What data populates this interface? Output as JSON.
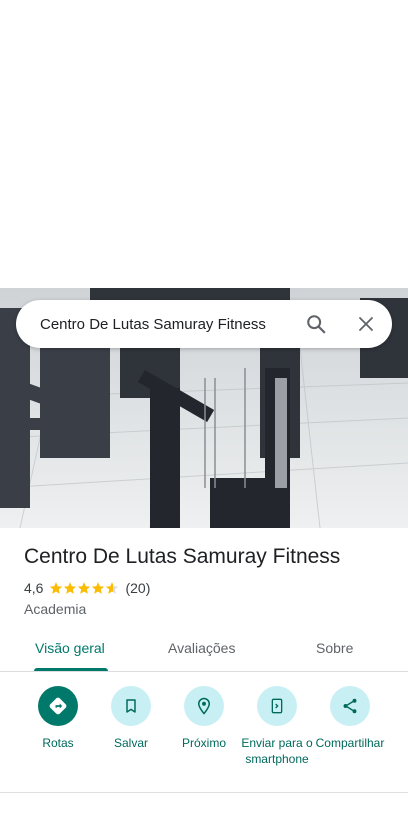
{
  "search": {
    "query": "Centro De Lutas Samuray Fitness"
  },
  "place": {
    "name": "Centro De Lutas Samuray Fitness",
    "rating": "4,6",
    "rating_value": 4.6,
    "review_count": "(20)",
    "category": "Academia"
  },
  "tabs": [
    {
      "label": "Visão geral",
      "active": true
    },
    {
      "label": "Avaliações",
      "active": false
    },
    {
      "label": "Sobre",
      "active": false
    }
  ],
  "actions": [
    {
      "label": "Rotas",
      "icon": "directions-icon"
    },
    {
      "label": "Salvar",
      "icon": "bookmark-icon"
    },
    {
      "label": "Próximo",
      "icon": "nearby-icon"
    },
    {
      "label": "Enviar para o smartphone",
      "icon": "send-to-phone-icon"
    },
    {
      "label": "Compartilhar",
      "icon": "share-icon"
    }
  ],
  "colors": {
    "accent": "#00796b",
    "action_bg": "#c8f0f4",
    "star": "#fbbc04"
  }
}
